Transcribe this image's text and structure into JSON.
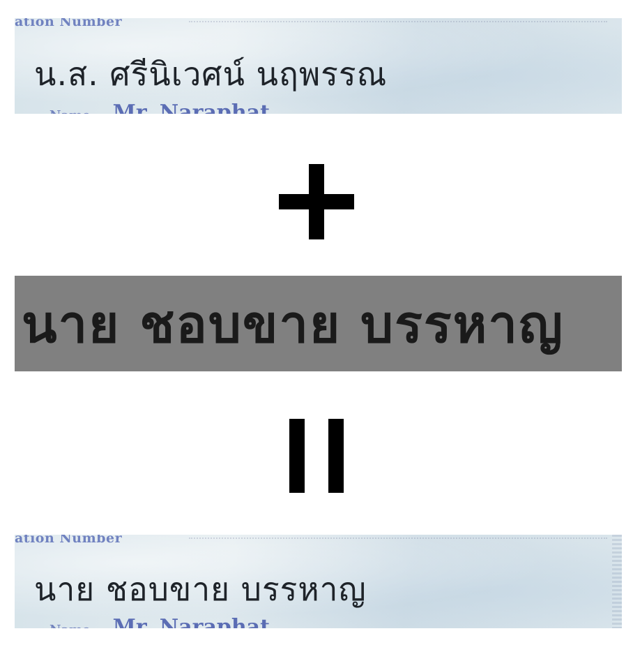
{
  "top_card": {
    "field_label": "ation Number",
    "name_text": "น.ส.  ศรีนิเวศน์  นฤพรรณ",
    "name_label": "Name",
    "english_name": "Mr. Naraphat"
  },
  "operators": {
    "plus": "+",
    "equals": "="
  },
  "banner": {
    "text": "นาย ชอบขาย บรรหาญ",
    "background_color": "#808080"
  },
  "result_card": {
    "field_label": "ation Number",
    "name_text": "นาย  ชอบขาย  บรรหาญ",
    "name_label": "Name",
    "english_name": "Mr. Naraphat"
  }
}
